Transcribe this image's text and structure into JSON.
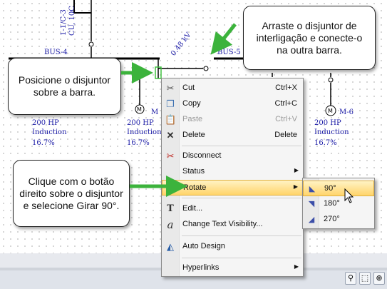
{
  "diagram": {
    "left_vertical_label": "1-1/C-3",
    "left_vertical_label2": "CU, 10C",
    "bus4_label": "BUS-4",
    "bus5_label": "BUS-5",
    "kv_label": "0.48 kV",
    "motor_center_label": "M",
    "motor_right_label": "M-6",
    "motor_left_hp": "200 HP",
    "motor_left_type": "Induction",
    "motor_left_pct": "16.7%",
    "motor_mid_hp": "200 HP",
    "motor_mid_type": "Induction",
    "motor_mid_pct": "16.7%",
    "motor_right_hp": "200 HP",
    "motor_right_type": "Induction",
    "motor_right_pct": "16.7%"
  },
  "callouts": {
    "top_right": "Arraste o disjuntor de interligação e conecte-o na outra barra.",
    "middle_left": "Posicione o disjuntor sobre a barra.",
    "bottom_left": "Clique com o botão direito sobre o disjuntor e selecione Girar 90°."
  },
  "context_menu": {
    "items": [
      {
        "label": "Cut",
        "shortcut": "Ctrl+X",
        "icon": "scissors-icon"
      },
      {
        "label": "Copy",
        "shortcut": "Ctrl+C",
        "icon": "copy-icon"
      },
      {
        "label": "Paste",
        "shortcut": "Ctrl+V",
        "icon": "paste-icon"
      },
      {
        "label": "Delete",
        "shortcut": "Delete",
        "icon": "delete-icon"
      },
      {
        "label": "Disconnect",
        "icon": "disconnect-icon"
      },
      {
        "label": "Status"
      },
      {
        "label": "Rotate"
      },
      {
        "label": "Edit...",
        "icon": "edit-icon"
      },
      {
        "label": "Change Text Visibility...",
        "icon": "text-visibility-icon"
      },
      {
        "label": "Auto Design",
        "icon": "auto-design-icon"
      },
      {
        "label": "Hyperlinks"
      }
    ]
  },
  "rotate_submenu": {
    "items": [
      {
        "label": "90°",
        "icon": "rotate-90-icon"
      },
      {
        "label": "180°",
        "icon": "rotate-180-icon"
      },
      {
        "label": "270°",
        "icon": "rotate-270-icon"
      }
    ]
  },
  "toolbar": {
    "icons": [
      "zoom-icon",
      "zoom-select-icon",
      "zoom-fit-icon"
    ]
  },
  "colors": {
    "diagram_text": "#1a1aa6",
    "arrow": "#3cb33c",
    "menu_highlight": "#ffd46a"
  }
}
